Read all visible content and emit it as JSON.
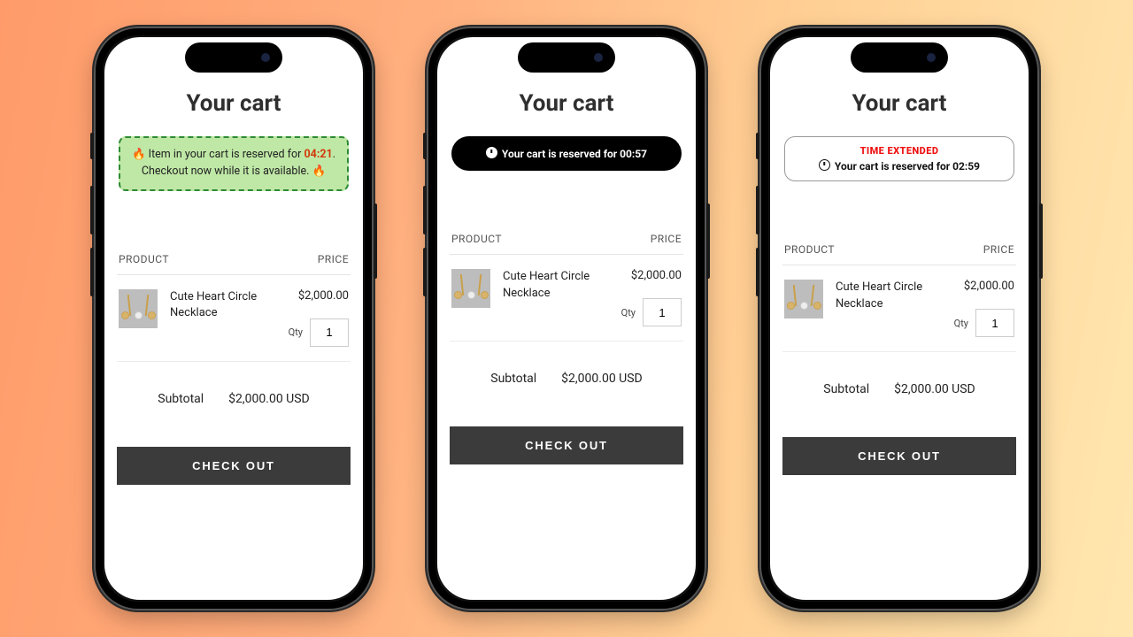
{
  "headings": {
    "title": "Your cart"
  },
  "columns": {
    "product": "PRODUCT",
    "price": "PRICE"
  },
  "product": {
    "name": "Cute Heart Circle Necklace",
    "price": "$2,000.00",
    "qty_label": "Qty",
    "qty_value": "1"
  },
  "subtotal": {
    "label": "Subtotal",
    "value": "$2,000.00 USD"
  },
  "checkout_label": "CHECK OUT",
  "phones": [
    {
      "banner": {
        "variant": "green",
        "line1_a": "🔥 Item in your cart is reserved for ",
        "timer": "04:21",
        "line1_b": ".",
        "line2": "Checkout now while it is available. 🔥"
      }
    },
    {
      "banner": {
        "variant": "dark",
        "text_a": "Your cart is reserved for ",
        "timer": "00:57"
      }
    },
    {
      "banner": {
        "variant": "white",
        "extended": "TIME EXTENDED",
        "text_a": "Your cart is reserved for ",
        "timer": "02:59"
      }
    }
  ]
}
